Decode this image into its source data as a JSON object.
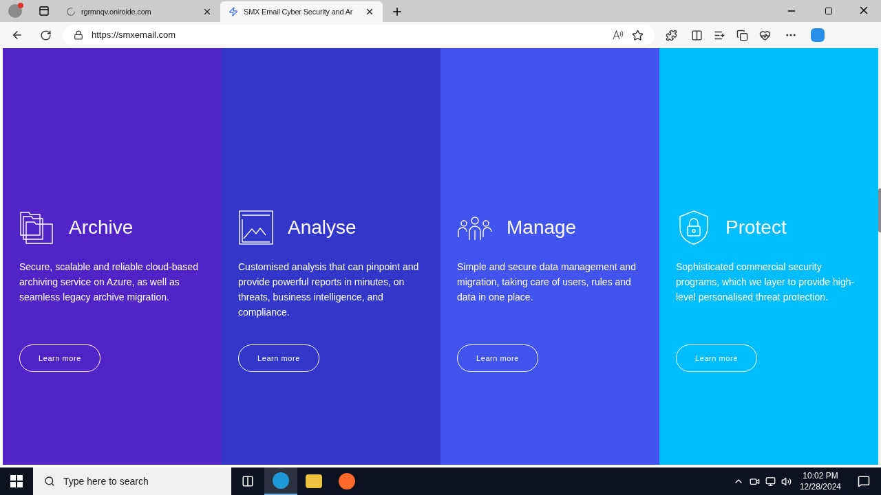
{
  "browser": {
    "tabs": [
      {
        "title": "rgrmnqv.oniroide.com",
        "selected": false,
        "loading": true
      },
      {
        "title": "SMX Email Cyber Security and Ar",
        "selected": true,
        "loading": false
      }
    ],
    "url": "https://smxemail.com"
  },
  "cards": [
    {
      "kind": "archive",
      "title": "Archive",
      "text": "Secure, scalable and reliable cloud-based archiving service on Azure, as well as seamless legacy archive migration.",
      "button": "Learn more",
      "color": "#5124c7"
    },
    {
      "kind": "analyse",
      "title": "Analyse",
      "text": "Customised analysis that can pinpoint and provide powerful reports in minutes, on threats, business intelligence, and compliance.",
      "button": "Learn more",
      "color": "#3237c9"
    },
    {
      "kind": "manage",
      "title": "Manage",
      "text": "Simple and secure data management and migration, taking care of users, rules and data in one place.",
      "button": "Learn more",
      "color": "#4254ee"
    },
    {
      "kind": "protect",
      "title": "Protect",
      "text": "Sophisticated commercial security programs, which we layer to provide high-level personalised threat protection.",
      "button": "Learn more",
      "color": "#00bdfe"
    }
  ],
  "taskbar": {
    "search_placeholder": "Type here to search",
    "time": "10:02 PM",
    "date": "12/28/2024"
  }
}
